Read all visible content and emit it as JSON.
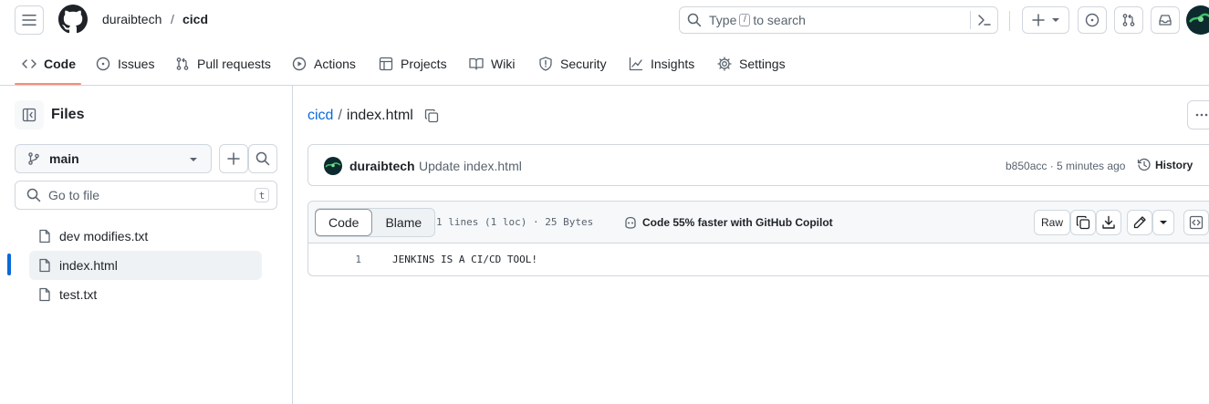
{
  "header": {
    "owner": "duraibtech",
    "separator": "/",
    "repo": "cicd",
    "search": {
      "prefix": "Type",
      "key": "/",
      "suffix": "to search"
    }
  },
  "repo_nav": {
    "tabs": [
      {
        "label": "Code",
        "icon": "code-icon"
      },
      {
        "label": "Issues",
        "icon": "issue-opened-icon"
      },
      {
        "label": "Pull requests",
        "icon": "git-pull-request-icon"
      },
      {
        "label": "Actions",
        "icon": "play-icon"
      },
      {
        "label": "Projects",
        "icon": "table-icon"
      },
      {
        "label": "Wiki",
        "icon": "book-icon"
      },
      {
        "label": "Security",
        "icon": "shield-icon"
      },
      {
        "label": "Insights",
        "icon": "graph-icon"
      },
      {
        "label": "Settings",
        "icon": "gear-icon"
      }
    ],
    "active": "Code"
  },
  "sidebar": {
    "title": "Files",
    "branch": "main",
    "go_to_file": {
      "placeholder": "Go to file",
      "shortcut": "t"
    },
    "files": [
      "dev modifies.txt",
      "index.html",
      "test.txt"
    ],
    "selected": "index.html"
  },
  "file": {
    "breadcrumb_repo": "cicd",
    "breadcrumb_sep": "/",
    "name": "index.html",
    "commit": {
      "author": "duraibtech",
      "message": "Update index.html",
      "sha_time": "b850acc · 5 minutes ago",
      "history_label": "History"
    },
    "toolbar": {
      "code_tab": "Code",
      "blame_tab": "Blame",
      "stats": "1 lines (1 loc) · 25 Bytes",
      "copilot": "Code 55% faster with GitHub Copilot",
      "raw": "Raw"
    },
    "lines": [
      {
        "number": "1",
        "text": "JENKINS IS A CI/CD TOOL!"
      }
    ]
  },
  "colors": {
    "accent_link": "#0969da",
    "selected_marker": "#0969da",
    "active_tab_underline": "#fd8c73",
    "border": "#d0d7de"
  }
}
